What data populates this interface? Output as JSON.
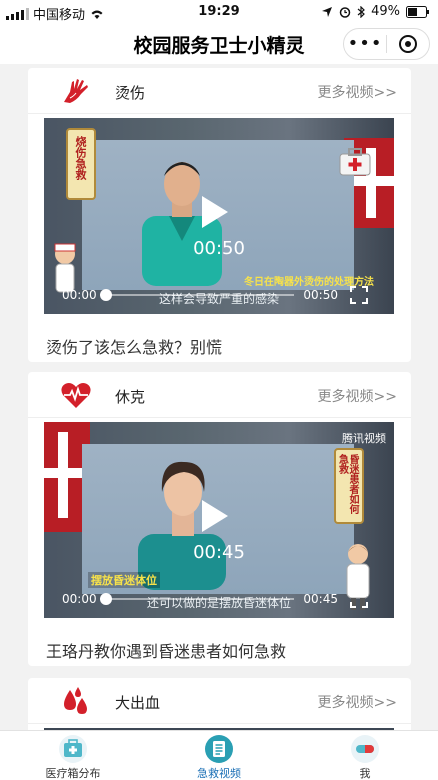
{
  "status_bar": {
    "carrier": "中国移动",
    "time": "19:29",
    "battery": "49%"
  },
  "nav": {
    "title": "校园服务卫士小精灵",
    "more_glyph": "•••"
  },
  "feed": {
    "cards": [
      {
        "category": "烫伤",
        "more": "更多视频>>",
        "video": {
          "duration": "00:50",
          "current": "00:00",
          "total": "00:50",
          "subtitle": "这样会导致严重的感染",
          "side_banner": "烧伤急救",
          "overlay_caption": "冬日在陶器外烫伤的处理方法"
        },
        "title": "烫伤了该怎么急救？别慌"
      },
      {
        "category": "休克",
        "more": "更多视频>>",
        "video": {
          "duration": "00:45",
          "current": "00:00",
          "total": "00:45",
          "subtitle": "还可以做的是摆放昏迷体位",
          "side_banner": "昏迷患者如何急救",
          "overlay_caption": "摆放昏迷体位",
          "brand": "腾讯视频"
        },
        "title": "王珞丹教你遇到昏迷患者如何急救"
      },
      {
        "category": "大出血",
        "more": "更多视频>>"
      }
    ]
  },
  "tabbar": {
    "tabs": [
      {
        "label": "医疗箱分布",
        "active": false
      },
      {
        "label": "急救视频",
        "active": true
      },
      {
        "label": "我",
        "active": false
      }
    ]
  },
  "colors": {
    "accent": "#1a6fb5",
    "danger": "#d3202a"
  }
}
